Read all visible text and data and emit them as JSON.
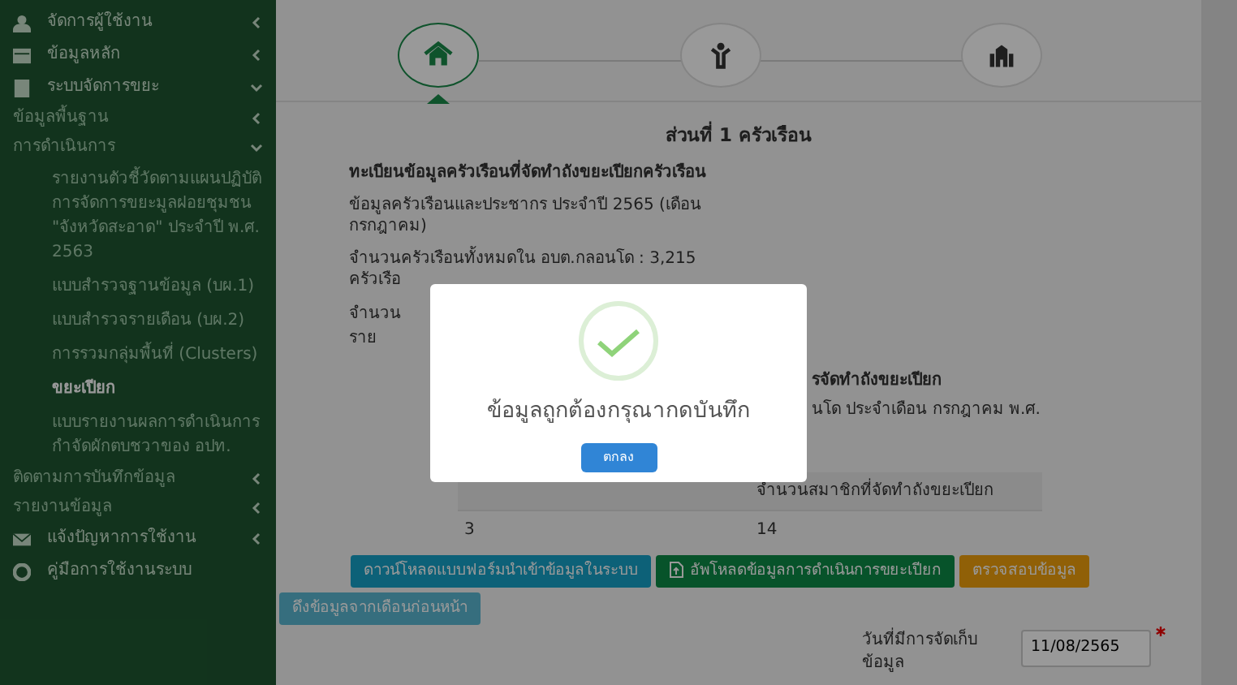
{
  "sidebar": {
    "items": [
      {
        "label": "จัดการผู้ใช้งาน",
        "expanded": false
      },
      {
        "label": "ข้อมูลหลัก",
        "expanded": false
      },
      {
        "label": "ระบบจัดการขยะ",
        "expanded": true,
        "children": [
          {
            "label": "ข้อมูลพื้นฐาน",
            "expanded": false
          },
          {
            "label": "การดำเนินการ",
            "expanded": true,
            "children": [
              {
                "label": "รายงานตัวชี้วัดตามแผนปฏิบัติการจัดการขยะมูลฝอยชุมชน \"จังหวัดสะอาด\" ประจำปี พ.ศ. 2563",
                "selected": false
              },
              {
                "label": "แบบสำรวจฐานข้อมูล (บผ.1)",
                "selected": false
              },
              {
                "label": "แบบสำรวจรายเดือน (บผ.2)",
                "selected": false
              },
              {
                "label": "การรวมกลุ่มพื้นที่ (Clusters)",
                "selected": false
              },
              {
                "label": "ขยะเปียก",
                "selected": true
              },
              {
                "label": "แบบรายงานผลการดำเนินการกำจัดผักตบชวาของ อปท.",
                "selected": false
              }
            ]
          },
          {
            "label": "ติดตามการบันทึกข้อมูล",
            "expanded": false
          },
          {
            "label": "รายงานข้อมูล",
            "expanded": false
          }
        ]
      },
      {
        "label": "แจ้งปัญหาการใช้งาน",
        "expanded": false
      },
      {
        "label": "คู่มือการใช้งานระบบ"
      }
    ]
  },
  "steps": [
    {
      "selected": true
    },
    {
      "selected": false
    },
    {
      "selected": false
    }
  ],
  "section_title": "ส่วนที่ 1 ครัวเรือน",
  "heading": "ทะเบียนข้อมูลครัวเรือนที่จัดทำถังขยะเปียกครัวเรือน",
  "info": [
    "ข้อมูลครัวเรือนและประชากร ประจำปี 2565 (เดือนกรกฎาคม)",
    "จำนวนครัวเรือนทั้งหมดใน อบต.กลอนโด : 3,215 ครัวเรือ"
  ],
  "info_cut": {
    "start": "จำนวน",
    "end": "ราย"
  },
  "table_caption": [
    "รจัดทำถังขยะเปียก",
    "นโด ประจำเดือน กรกฎาคม พ.ศ."
  ],
  "table": {
    "columns": [
      "",
      "จำนวนสมาชิกที่จัดทำถังขยะเปียก"
    ],
    "rows": [
      [
        "3",
        "14"
      ]
    ]
  },
  "buttons": [
    {
      "label": "ดาวน์โหลดแบบฟอร์มนำเข้าข้อมูลในระบบ",
      "kind": "download"
    },
    {
      "label": "อัพโหลดข้อมูลการดำเนินการขยะเปียก",
      "kind": "upload"
    },
    {
      "label": "ตรวจสอบข้อมูล",
      "kind": "verify"
    },
    {
      "label": "ดึงข้อมูลจากเดือนก่อนหน้า",
      "kind": "copy"
    }
  ],
  "date_field": {
    "label": "วันที่มีการจัดเก็บข้อมูล",
    "value": "11/08/2565",
    "required": true
  },
  "dialog": {
    "message": "ข้อมูลถูกต้องกรุณากดบันทึก",
    "button": "ตกลง"
  }
}
